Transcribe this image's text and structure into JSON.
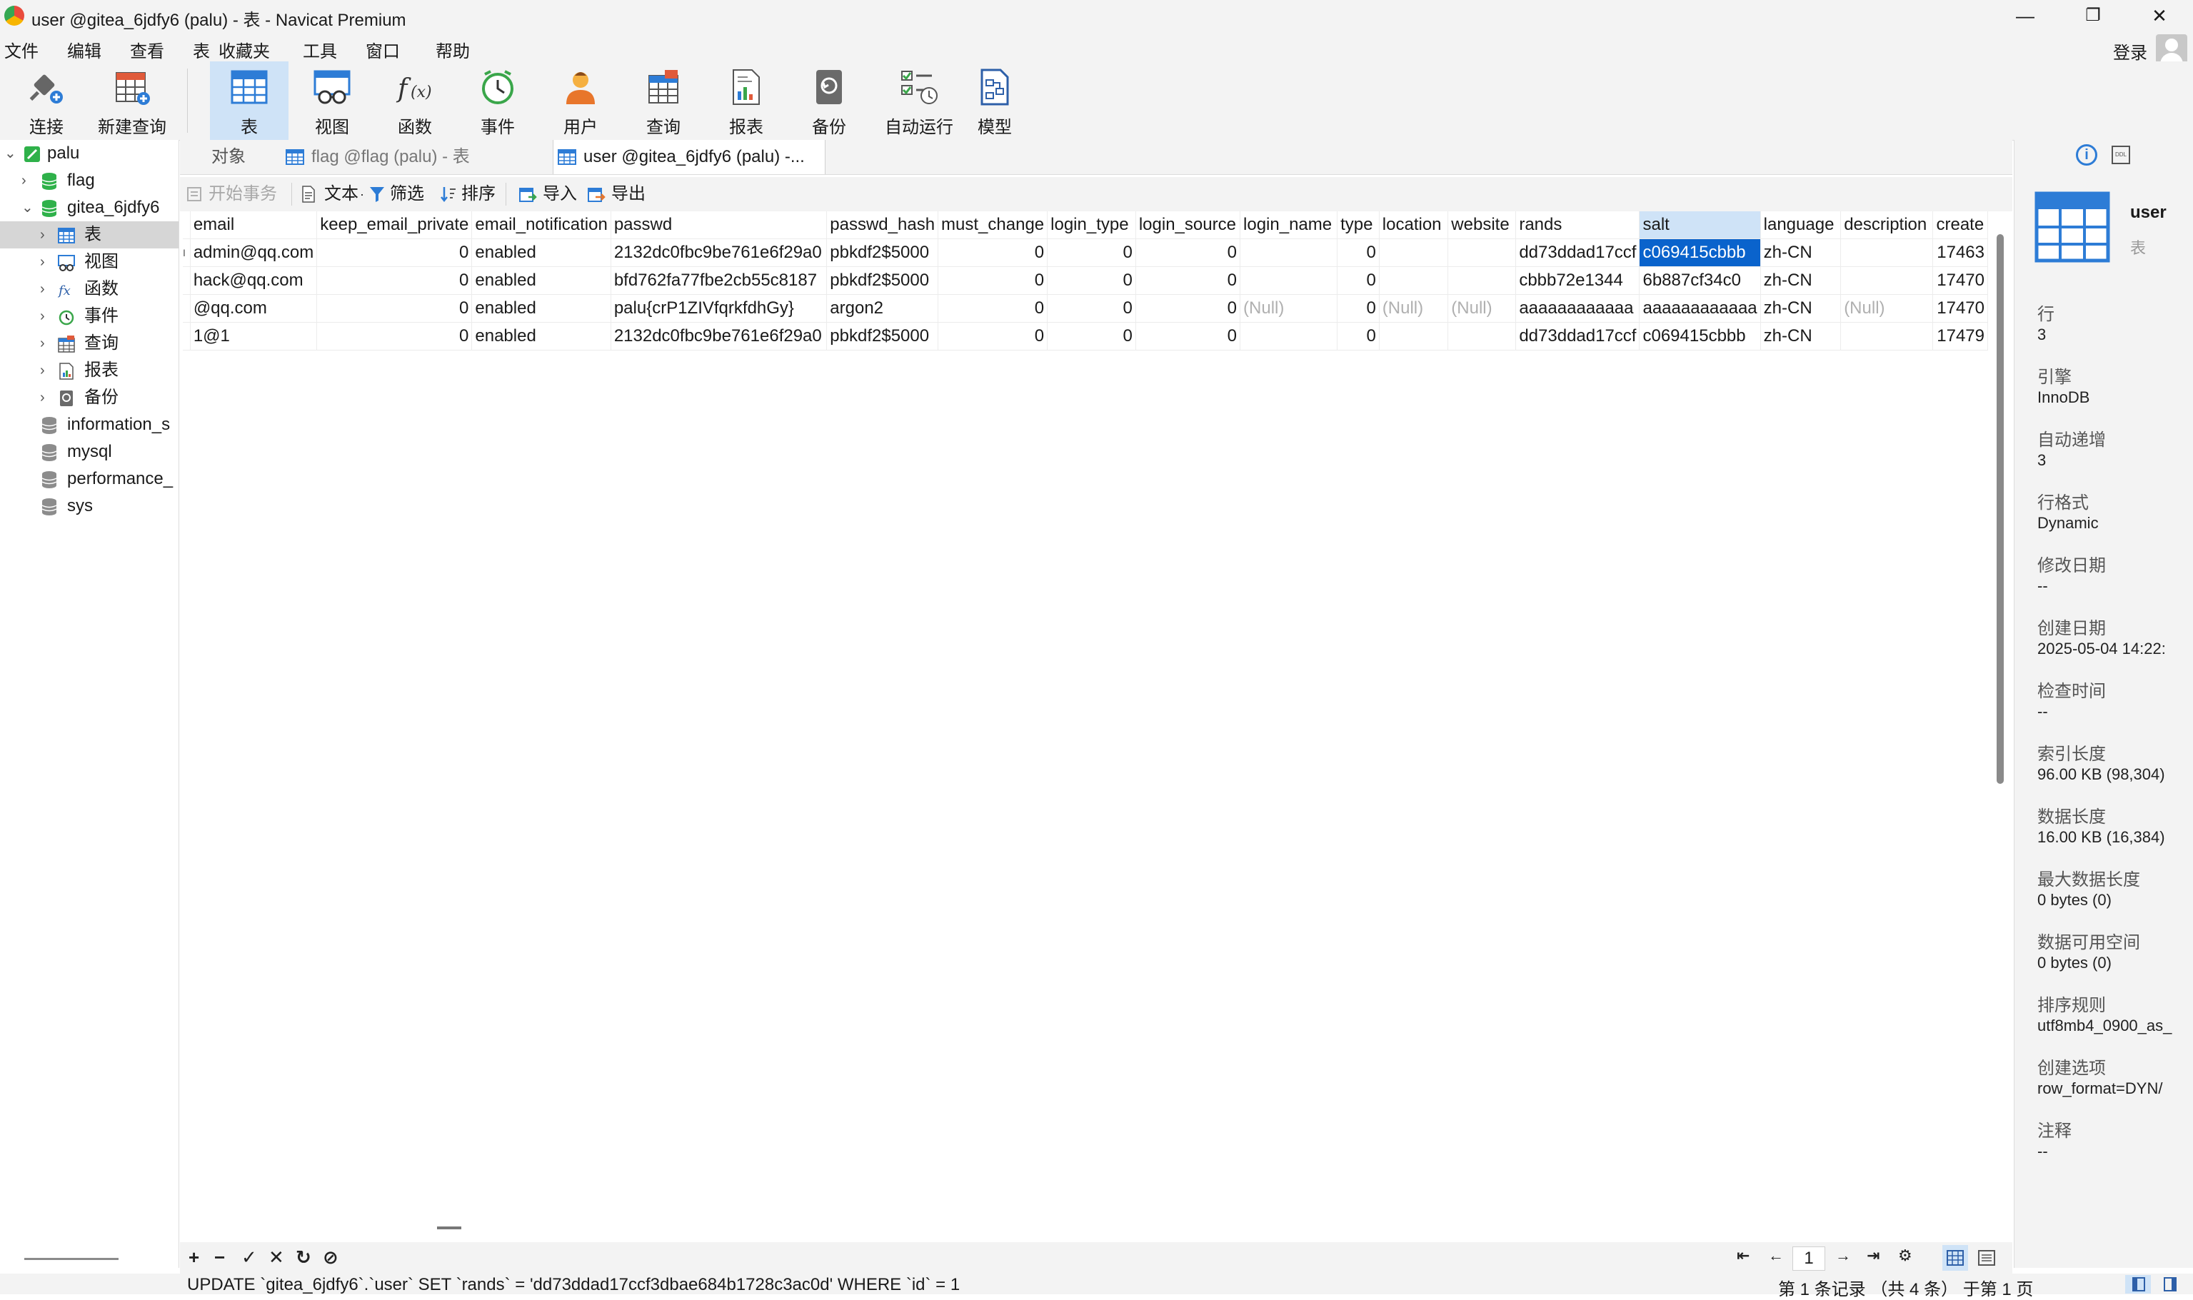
{
  "window": {
    "title": "user @gitea_6jdfy6 (palu) - 表 - Navicat Premium",
    "minimize": "—",
    "restore": "❐",
    "close": "✕"
  },
  "menu": {
    "items": [
      "文件",
      "编辑",
      "查看",
      "表",
      "收藏夹",
      "工具",
      "窗口",
      "帮助"
    ],
    "login": "登录"
  },
  "toolbar": {
    "buttons": [
      "连接",
      "新建查询",
      "表",
      "视图",
      "函数",
      "事件",
      "用户",
      "查询",
      "报表",
      "备份",
      "自动运行",
      "模型"
    ]
  },
  "tree": {
    "items": [
      "palu",
      "flag",
      "gitea_6jdfy6",
      "表",
      "视图",
      "函数",
      "事件",
      "查询",
      "报表",
      "备份",
      "information_s",
      "mysql",
      "performance_",
      "sys"
    ]
  },
  "tabs": {
    "objects": "对象",
    "tab1": "flag @flag (palu) - 表",
    "tab2": "user @gitea_6jdfy6 (palu) -..."
  },
  "subtoolbar": {
    "begin_tx": "开始事务",
    "text": "文本",
    "filter": "筛选",
    "sort": "排序",
    "import": "导入",
    "export": "导出"
  },
  "grid": {
    "columns": [
      "email",
      "keep_email_private",
      "email_notification",
      "passwd",
      "passwd_hash",
      "must_change",
      "login_type",
      "login_source",
      "login_name",
      "type",
      "location",
      "website",
      "rands",
      "salt",
      "language",
      "description",
      "create"
    ],
    "rows": [
      [
        "admin@qq.com",
        "0",
        "enabled",
        "2132dc0fbc9be761e6f29a0",
        "pbkdf2$5000",
        "0",
        "0",
        "0",
        "",
        "0",
        "",
        "",
        "dd73ddad17ccf",
        "c069415cbbb",
        "zh-CN",
        "",
        "17463"
      ],
      [
        "hack@qq.com",
        "0",
        "enabled",
        "bfd762fa77fbe2cb55c8187",
        "pbkdf2$5000",
        "0",
        "0",
        "0",
        "",
        "0",
        "",
        "",
        "cbbb72e1344",
        "6b887cf34c0",
        "zh-CN",
        "",
        "17470"
      ],
      [
        "@qq.com",
        "0",
        "enabled",
        "palu{crP1ZIVfqrkfdhGy}",
        "argon2",
        "0",
        "0",
        "0",
        "(Null)",
        "0",
        "(Null)",
        "(Null)",
        "aaaaaaaaaaaa",
        "aaaaaaaaaaaa",
        "zh-CN",
        "(Null)",
        "17470"
      ],
      [
        "1@1",
        "0",
        "enabled",
        "2132dc0fbc9be761e6f29a0",
        "pbkdf2$5000",
        "0",
        "0",
        "0",
        "",
        "0",
        "",
        "",
        "dd73ddad17ccf",
        "c069415cbbb",
        "zh-CN",
        "",
        "17479"
      ]
    ]
  },
  "properties": {
    "name": "user",
    "type": "表",
    "fields": [
      {
        "label": "行",
        "value": "3"
      },
      {
        "label": "引擎",
        "value": "InnoDB"
      },
      {
        "label": "自动递增",
        "value": "3"
      },
      {
        "label": "行格式",
        "value": "Dynamic"
      },
      {
        "label": "修改日期",
        "value": "--"
      },
      {
        "label": "创建日期",
        "value": "2025-05-04 14:22:"
      },
      {
        "label": "检查时间",
        "value": "--"
      },
      {
        "label": "索引长度",
        "value": "96.00 KB (98,304)"
      },
      {
        "label": "数据长度",
        "value": "16.00 KB (16,384)"
      },
      {
        "label": "最大数据长度",
        "value": "0 bytes (0)"
      },
      {
        "label": "数据可用空间",
        "value": "0 bytes (0)"
      },
      {
        "label": "排序规则",
        "value": "utf8mb4_0900_as_"
      },
      {
        "label": "创建选项",
        "value": "row_format=DYN/"
      },
      {
        "label": "注释",
        "value": "--"
      }
    ]
  },
  "bottom": {
    "page": "1",
    "sql": "UPDATE `gitea_6jdfy6`.`user` SET `rands` = 'dd73ddad17ccf3dbae684b1728c3ac0d' WHERE `id` = 1",
    "record_info": "第 1 条记录 （共 4 条） 于第 1 页"
  }
}
